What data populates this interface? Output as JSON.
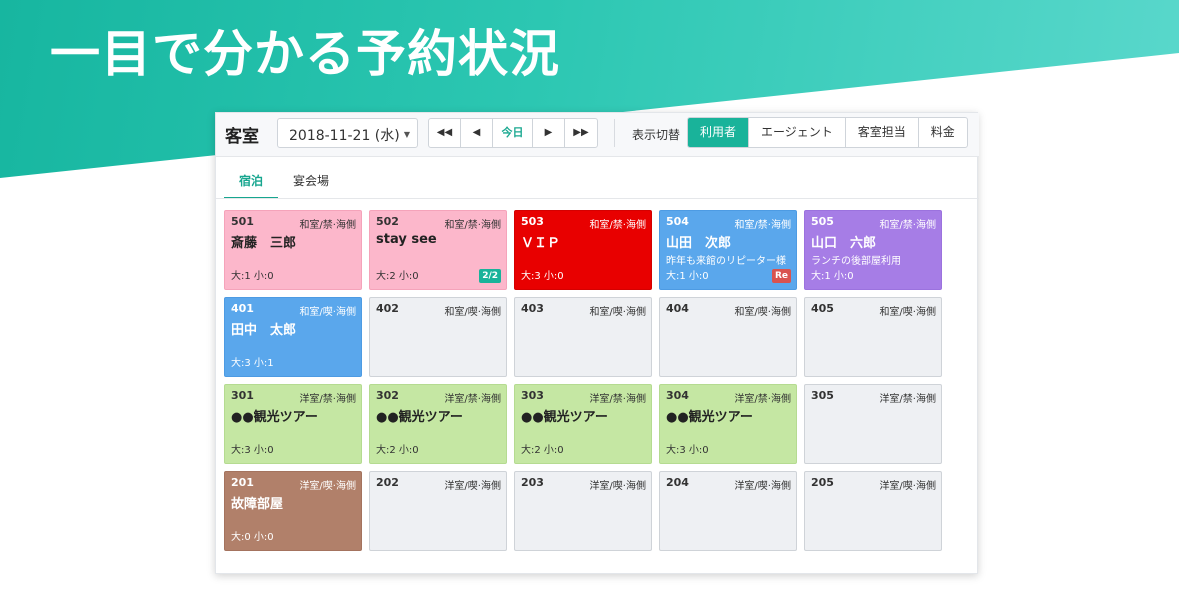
{
  "headline": "一目で分かる予約状況",
  "toolbar": {
    "title": "客室",
    "date": "2018-11-21 (水)",
    "nav": {
      "first": "◀◀",
      "prev": "◀",
      "today": "今日",
      "next": "▶",
      "last": "▶▶"
    },
    "view_label": "表示切替",
    "view_buttons": [
      "利用者",
      "エージェント",
      "客室担当",
      "料金"
    ],
    "active_view": "利用者"
  },
  "tabs": [
    "宿泊",
    "宴会場"
  ],
  "active_tab": "宿泊",
  "colors": {
    "accent": "#19b39a",
    "pink": "#fcb7cb",
    "red": "#e80000",
    "blue": "#5aa7ec",
    "purple": "#a67de6",
    "green": "#c5e7a3",
    "brown": "#b1806a",
    "empty": "#eef0f3",
    "badge_teal": "#19b39a",
    "badge_red": "#d9534f"
  },
  "rooms": [
    [
      {
        "number": "501",
        "type": "和室/禁·海側",
        "guest": "斎藤　三郎",
        "note": "",
        "occupancy": "大:1 小:0",
        "badge": "",
        "status": "pink"
      },
      {
        "number": "502",
        "type": "和室/禁·海側",
        "guest": "stay see",
        "note": "",
        "occupancy": "大:2 小:0",
        "badge": "2/2",
        "status": "pink"
      },
      {
        "number": "503",
        "type": "和室/禁·海側",
        "guest": "ＶＩＰ",
        "note": "",
        "occupancy": "大:3 小:0",
        "badge": "",
        "status": "red"
      },
      {
        "number": "504",
        "type": "和室/禁·海側",
        "guest": "山田　次郎",
        "note": "昨年も来館のリピーター様",
        "occupancy": "大:1 小:0",
        "badge": "Re",
        "status": "blue"
      },
      {
        "number": "505",
        "type": "和室/禁·海側",
        "guest": "山口　六郎",
        "note": "ランチの後部屋利用",
        "occupancy": "大:1 小:0",
        "badge": "",
        "status": "purple"
      }
    ],
    [
      {
        "number": "401",
        "type": "和室/喫·海側",
        "guest": "田中　太郎",
        "note": "",
        "occupancy": "大:3 小:1",
        "badge": "",
        "status": "blue"
      },
      {
        "number": "402",
        "type": "和室/喫·海側",
        "guest": "",
        "note": "",
        "occupancy": "",
        "badge": "",
        "status": "empty"
      },
      {
        "number": "403",
        "type": "和室/喫·海側",
        "guest": "",
        "note": "",
        "occupancy": "",
        "badge": "",
        "status": "empty"
      },
      {
        "number": "404",
        "type": "和室/喫·海側",
        "guest": "",
        "note": "",
        "occupancy": "",
        "badge": "",
        "status": "empty"
      },
      {
        "number": "405",
        "type": "和室/喫·海側",
        "guest": "",
        "note": "",
        "occupancy": "",
        "badge": "",
        "status": "empty"
      }
    ],
    [
      {
        "number": "301",
        "type": "洋室/禁·海側",
        "guest": "●●観光ツアー",
        "note": "",
        "occupancy": "大:3 小:0",
        "badge": "",
        "status": "green"
      },
      {
        "number": "302",
        "type": "洋室/禁·海側",
        "guest": "●●観光ツアー",
        "note": "",
        "occupancy": "大:2 小:0",
        "badge": "",
        "status": "green"
      },
      {
        "number": "303",
        "type": "洋室/禁·海側",
        "guest": "●●観光ツアー",
        "note": "",
        "occupancy": "大:2 小:0",
        "badge": "",
        "status": "green"
      },
      {
        "number": "304",
        "type": "洋室/禁·海側",
        "guest": "●●観光ツアー",
        "note": "",
        "occupancy": "大:3 小:0",
        "badge": "",
        "status": "green"
      },
      {
        "number": "305",
        "type": "洋室/禁·海側",
        "guest": "",
        "note": "",
        "occupancy": "",
        "badge": "",
        "status": "empty"
      }
    ],
    [
      {
        "number": "201",
        "type": "洋室/喫·海側",
        "guest": "故障部屋",
        "note": "",
        "occupancy": "大:0 小:0",
        "badge": "",
        "status": "brown"
      },
      {
        "number": "202",
        "type": "洋室/喫·海側",
        "guest": "",
        "note": "",
        "occupancy": "",
        "badge": "",
        "status": "empty"
      },
      {
        "number": "203",
        "type": "洋室/喫·海側",
        "guest": "",
        "note": "",
        "occupancy": "",
        "badge": "",
        "status": "empty"
      },
      {
        "number": "204",
        "type": "洋室/喫·海側",
        "guest": "",
        "note": "",
        "occupancy": "",
        "badge": "",
        "status": "empty"
      },
      {
        "number": "205",
        "type": "洋室/喫·海側",
        "guest": "",
        "note": "",
        "occupancy": "",
        "badge": "",
        "status": "empty"
      }
    ]
  ]
}
